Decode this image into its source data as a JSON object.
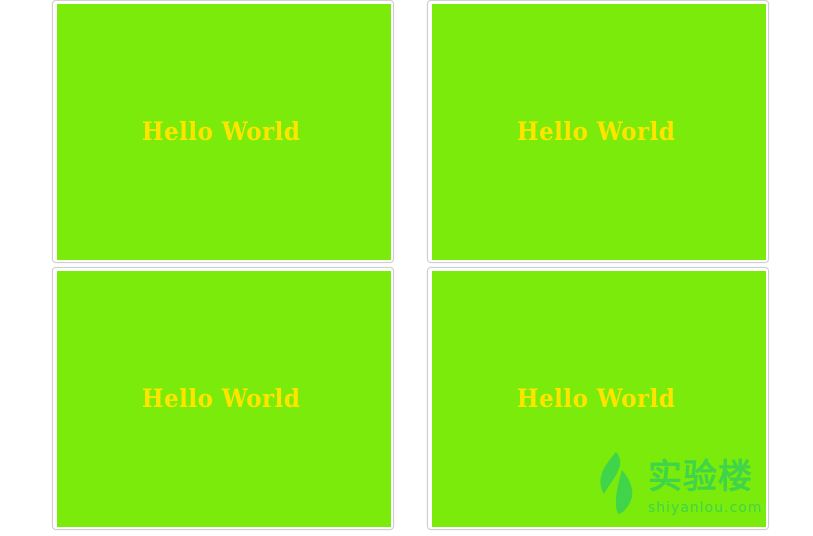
{
  "cards": [
    {
      "text": "Hello World"
    },
    {
      "text": "Hello World"
    },
    {
      "text": "Hello World"
    },
    {
      "text": "Hello World"
    }
  ],
  "watermark": {
    "chinese": "实验楼",
    "domain": "shiyanlou.com",
    "icon": "leaf-logo-icon"
  },
  "colors": {
    "panel": "#7aeb0b",
    "text": "#ffe400",
    "watermark": "#3fd44a"
  }
}
